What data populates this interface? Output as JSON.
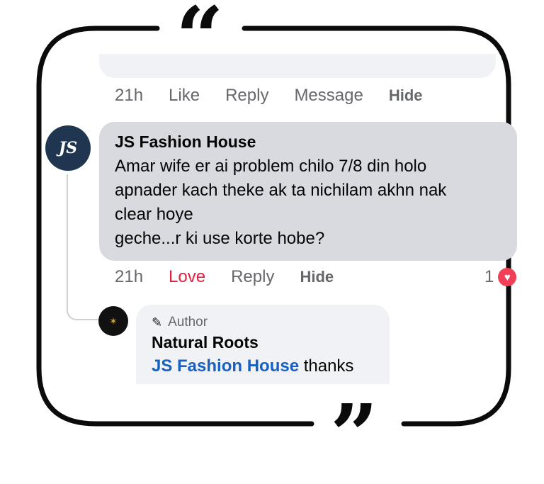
{
  "quotes": {
    "open": "“",
    "close": "”"
  },
  "previous_comment": {
    "actions": {
      "time": "21h",
      "like": "Like",
      "reply": "Reply",
      "message": "Message",
      "hide": "Hide"
    }
  },
  "comment": {
    "author": "JS Fashion House",
    "avatar_text": "JS",
    "lines": [
      "Amar wife er ai problem chilo 7/8 din holo",
      "apnader kach theke ak ta nichilam akhn nak",
      "clear hoye",
      "geche...r ki use korte hobe?"
    ],
    "actions": {
      "time": "21h",
      "love": "Love",
      "reply": "Reply",
      "hide": "Hide"
    },
    "reaction_count": "1",
    "reaction_icon": "heart-reaction-icon"
  },
  "reply": {
    "badge": "Author",
    "author": "Natural Roots",
    "mention": "JS Fashion House",
    "text": " thanks"
  },
  "colors": {
    "love": "#e41e3f",
    "mention": "#1861c4",
    "bubble_gray": "#d8dadf",
    "bubble_light": "#f0f2f5",
    "heart": "#f33e58"
  }
}
